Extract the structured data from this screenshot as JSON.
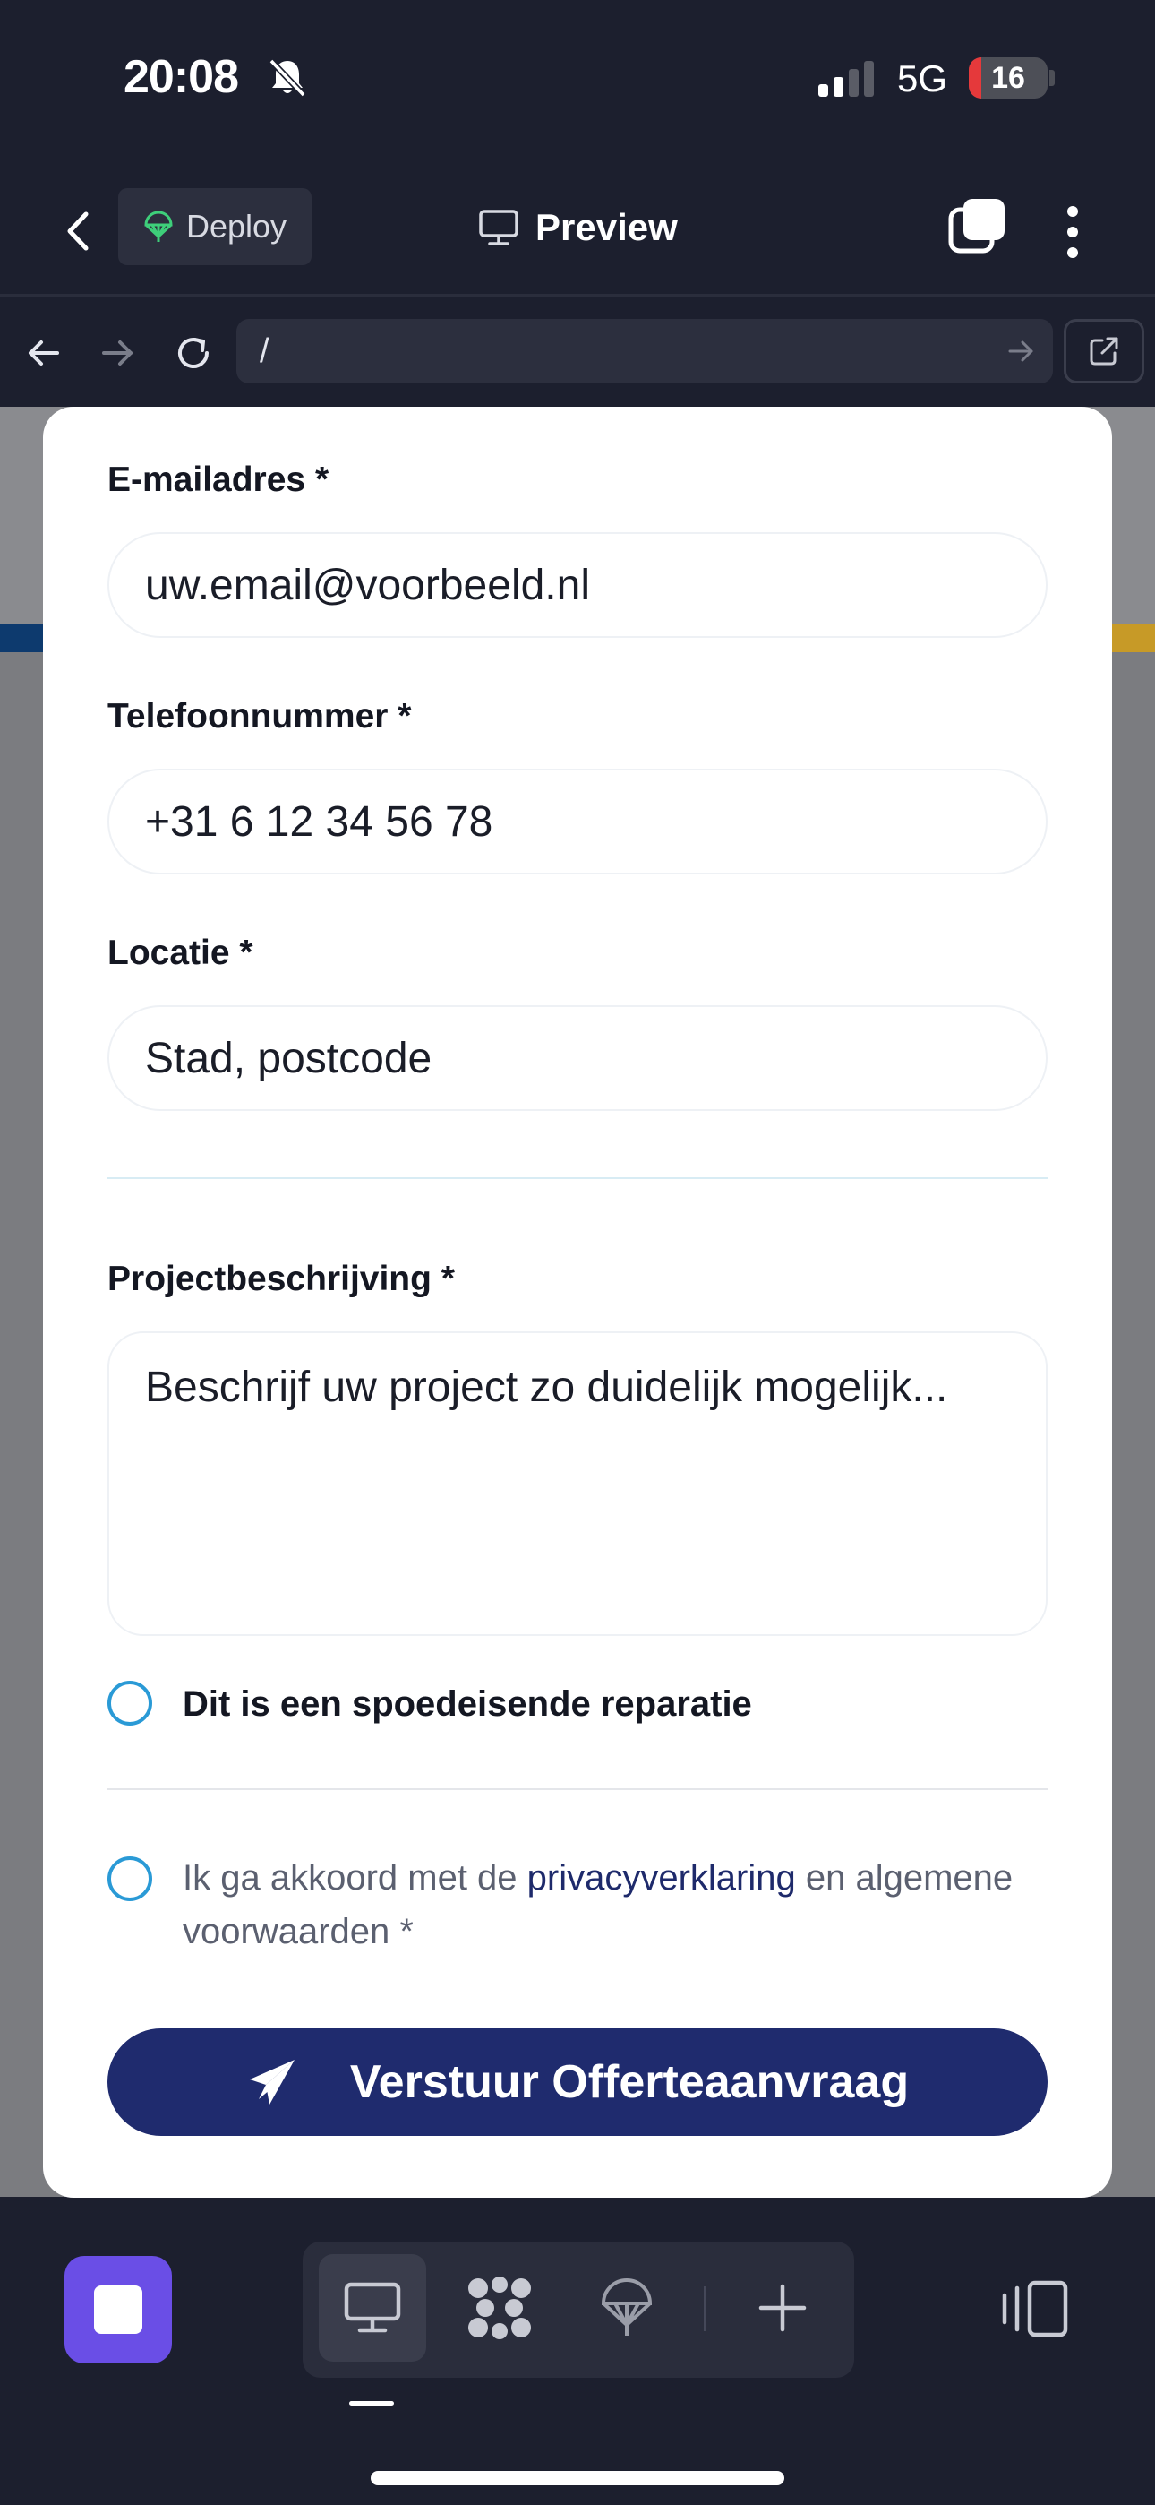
{
  "status_bar": {
    "time": "20:08",
    "network": "5G",
    "battery_level": "16",
    "battery_fraction": 0.16,
    "icons": [
      "bell-slash-icon",
      "cellular-signal-icon",
      "battery-icon"
    ]
  },
  "header": {
    "deploy_label": "Deploy",
    "title": "Preview"
  },
  "browser": {
    "url": "/"
  },
  "form": {
    "email": {
      "label": "E-mailadres *",
      "placeholder": "uw.email@voorbeeld.nl"
    },
    "phone": {
      "label": "Telefoonnummer *",
      "placeholder": "+31 6 12 34 56 78"
    },
    "location": {
      "label": "Locatie *",
      "placeholder": "Stad, postcode"
    },
    "description": {
      "label": "Projectbeschrijving *",
      "placeholder": "Beschrijf uw project zo duidelijk mogelijk..."
    },
    "urgent_label": "Dit is een spoedeisende reparatie",
    "consent": {
      "prefix": "Ik ga akkoord met de ",
      "link": "privacyverklaring",
      "suffix": " en algemene voorwaarden *"
    },
    "submit_label": "Verstuur Offerteaanvraag"
  },
  "colors": {
    "app_bg": "#1c1f2e",
    "accent_purple": "#6a4ee6",
    "submit_blue": "#1f2b6e",
    "radio_blue": "#2a9ad6",
    "battery_red": "#e5393b"
  }
}
